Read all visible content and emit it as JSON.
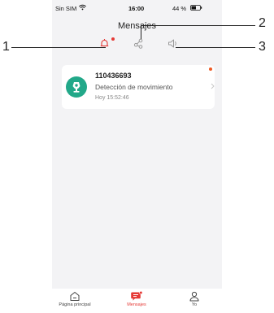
{
  "status_bar": {
    "carrier": "Sin SIM",
    "time": "16:00",
    "battery": "44 %"
  },
  "header": {
    "title": "Mensajes"
  },
  "tabs": [
    {
      "icon": "bell-icon",
      "active": true,
      "unread": true
    },
    {
      "icon": "share-icon",
      "active": false,
      "unread": false
    },
    {
      "icon": "speaker-icon",
      "active": false,
      "unread": false
    }
  ],
  "messages": [
    {
      "device_id": "110436693",
      "text": "Detección de movimiento",
      "time": "Hoy 15:52:46",
      "unread": true,
      "icon": "camera-icon"
    }
  ],
  "bottom_nav": [
    {
      "label": "Página principal",
      "icon": "home-icon",
      "active": false
    },
    {
      "label": "Mensajes",
      "icon": "message-icon",
      "active": true
    },
    {
      "label": "Yo",
      "icon": "user-icon",
      "active": false
    }
  ],
  "callouts": [
    "1",
    "2",
    "3"
  ],
  "colors": {
    "accent": "#e53935",
    "avatar": "#22a889",
    "background": "#f3f3f5",
    "inactive_icon": "#9a9a9a"
  }
}
